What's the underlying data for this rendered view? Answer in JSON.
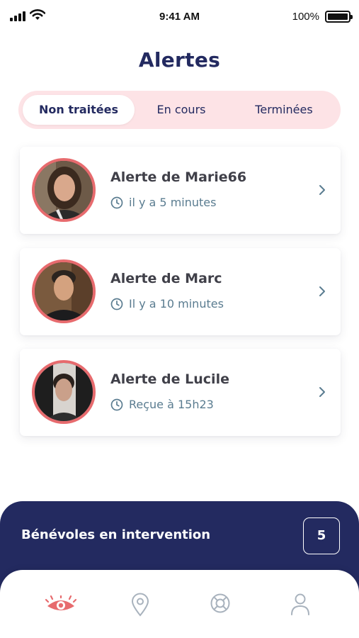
{
  "status_bar": {
    "time": "9:41 AM",
    "battery": "100%"
  },
  "page_title": "Alertes",
  "tabs": [
    {
      "label": "Non traitées",
      "active": true
    },
    {
      "label": "En cours",
      "active": false
    },
    {
      "label": "Terminées",
      "active": false
    }
  ],
  "alerts": [
    {
      "title": "Alerte de Marie66",
      "time": "il y a 5 minutes"
    },
    {
      "title": "Alerte de Marc",
      "time": "Il y a 10 minutes"
    },
    {
      "title": "Alerte de Lucile",
      "time": "Reçue à 15h23"
    }
  ],
  "volunteers": {
    "label": "Bénévoles en intervention",
    "count": "5"
  },
  "bottom_nav": [
    "eye-icon",
    "location-pin-icon",
    "lifebuoy-icon",
    "profile-icon"
  ],
  "colors": {
    "navy": "#232a60",
    "accent": "#e76b6e",
    "tab_bg": "#fde3e6",
    "muted_blue": "#5a7c90"
  }
}
